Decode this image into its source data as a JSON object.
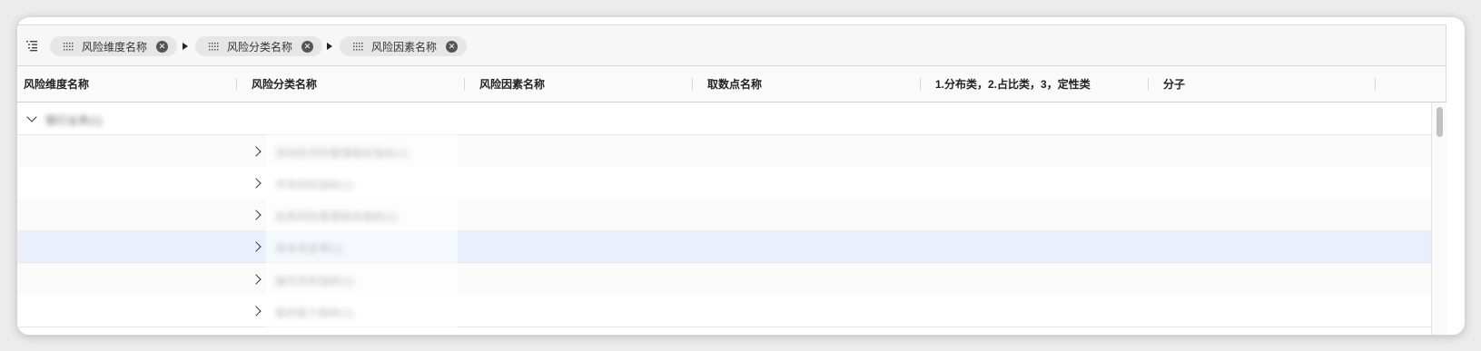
{
  "group_bar": {
    "icon": "tree-list-icon",
    "chips": [
      {
        "label": "风险维度名称"
      },
      {
        "label": "风险分类名称"
      },
      {
        "label": "风险因素名称"
      }
    ],
    "remove_icon": "close-circle-icon",
    "drag_icon": "drag-grip-icon"
  },
  "columns": [
    {
      "label": "风险维度名称"
    },
    {
      "label": "风险分类名称"
    },
    {
      "label": "风险因素名称"
    },
    {
      "label": "取数点名称"
    },
    {
      "label": "1.分布类，2.占比类，3，定性类"
    },
    {
      "label": "分子"
    }
  ],
  "rows": [
    {
      "level": 0,
      "expanded": true,
      "label": "银行业务(1)"
    },
    {
      "level": 1,
      "expanded": false,
      "label": "流动性风险管理相关指标(1)"
    },
    {
      "level": 1,
      "expanded": false,
      "label": "市场风险指标(1)"
    },
    {
      "level": 1,
      "expanded": false,
      "label": "信用风险管理相关指标(1)"
    },
    {
      "level": 1,
      "expanded": false,
      "label": "资本充足率(1)",
      "selected": true
    },
    {
      "level": 1,
      "expanded": false,
      "label": "操作风险指标(1)"
    },
    {
      "level": 1,
      "expanded": false,
      "label": "盈利能力指标(1)"
    }
  ],
  "colors": {
    "selected_row": "#e9f0fb",
    "chip_background": "#e6e6e6"
  }
}
